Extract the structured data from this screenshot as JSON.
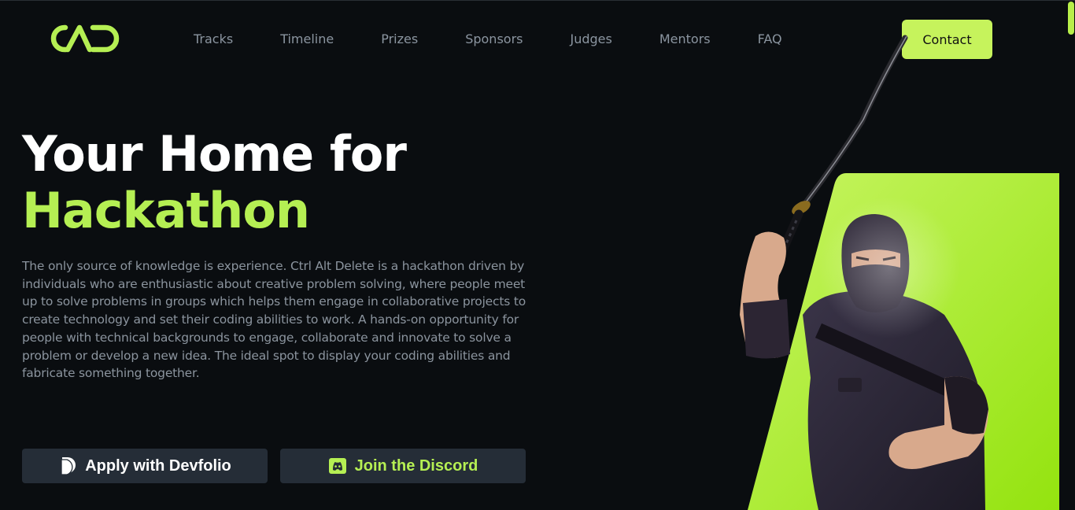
{
  "header": {
    "logo_icon": "ctrl-alt-delete-logo",
    "nav": [
      {
        "label": "Tracks"
      },
      {
        "label": "Timeline"
      },
      {
        "label": "Prizes"
      },
      {
        "label": "Sponsors"
      },
      {
        "label": "Judges"
      },
      {
        "label": "Mentors"
      },
      {
        "label": "FAQ"
      }
    ],
    "contact_label": "Contact"
  },
  "hero": {
    "title_line1": "Your Home for",
    "title_line2": "Hackathon",
    "description": "The only source of knowledge is experience. Ctrl Alt Delete is a hackathon driven by individuals who are enthusiastic about creative problem solving, where people meet up to solve problems in groups which helps them engage in collaborative projects to create technology and set their coding abilities to work. A hands-on opportunity for people with technical backgrounds to engage, collaborate and innovate to solve a problem or develop a new idea. The ideal spot to display your coding abilities and fabricate something together.",
    "devfolio_label": "Apply with Devfolio",
    "devfolio_icon": "devfolio-icon",
    "discord_label": "Join the Discord",
    "discord_icon": "discord-icon",
    "image": "ninja-with-katana-illustration"
  },
  "colors": {
    "background": "#0a0d10",
    "accent": "#b5ef53",
    "button_bg": "#252d37",
    "nav_text": "#8b95a0"
  }
}
